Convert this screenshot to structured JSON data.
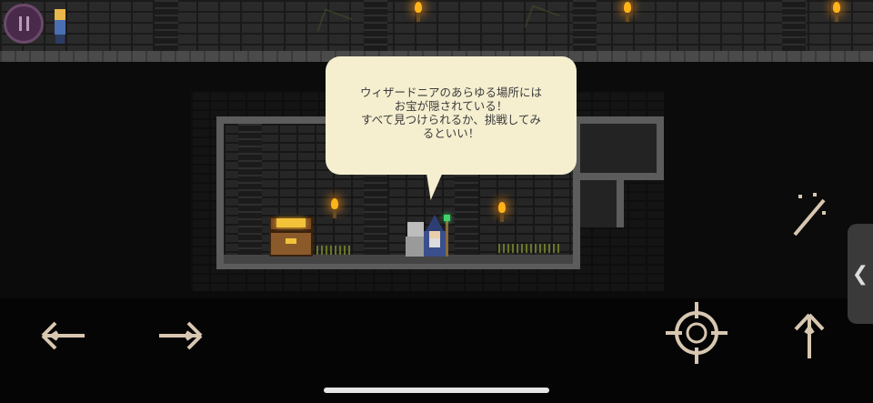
{
  "dialog": {
    "speaker": "wizard",
    "text": "ウィザードニアのあらゆる場所には\nお宝が隠されている！\nすべて見つけられるか、挑戦してみ\nるといい！"
  },
  "hud": {
    "pause_icon": "pause-icon",
    "move_left_icon": "arrow-left-icon",
    "move_right_icon": "arrow-right-icon",
    "magic_icon": "magic-wand-icon",
    "aim_icon": "crosshair-icon",
    "jump_icon": "arrow-up-icon",
    "side_tab_icon": "chevron-left-icon",
    "side_tab_glyph": "❮"
  },
  "colors": {
    "bubble_bg": "#f5efd0",
    "control_tint": "#d8c7b0",
    "torch_flame": "#ffb31a"
  }
}
